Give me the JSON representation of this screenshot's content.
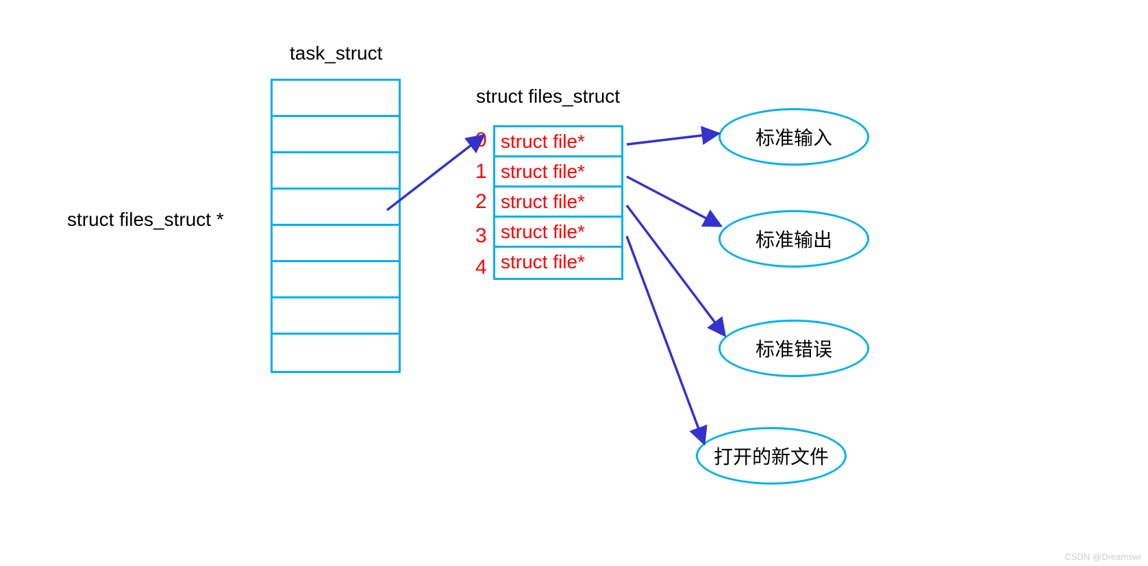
{
  "task_struct": {
    "title": "task_struct",
    "pointer_label": "struct files_struct *"
  },
  "files_struct": {
    "title": "struct files_struct",
    "entries": [
      {
        "index": "0",
        "text": "struct file*"
      },
      {
        "index": "1",
        "text": "struct file*"
      },
      {
        "index": "2",
        "text": "struct file*"
      },
      {
        "index": "3",
        "text": "struct file*"
      },
      {
        "index": "4",
        "text": "struct file*"
      }
    ]
  },
  "targets": {
    "stdin": "标准输入",
    "stdout": "标准输出",
    "stderr": "标准错误",
    "newfile": "打开的新文件"
  },
  "watermark": "CSDN @Dreamswi"
}
